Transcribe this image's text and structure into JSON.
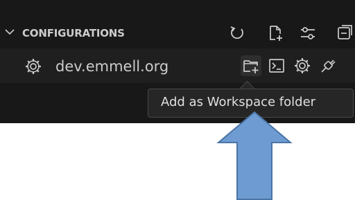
{
  "section": {
    "title": "CONFIGURATIONS",
    "header_icons": [
      "refresh-icon",
      "new-file-icon",
      "filter-settings-icon",
      "collapse-icon"
    ]
  },
  "item": {
    "label": "dev.emmell.org",
    "icon": "gear-icon",
    "action_icons": [
      "add-folder-icon",
      "terminal-icon",
      "settings-gear-icon",
      "connect-plug-icon"
    ]
  },
  "tooltip": {
    "text": "Add as Workspace folder"
  },
  "annotation": {
    "arrow_color": "#6e9bd1",
    "arrow_border": "#4a74a6"
  }
}
